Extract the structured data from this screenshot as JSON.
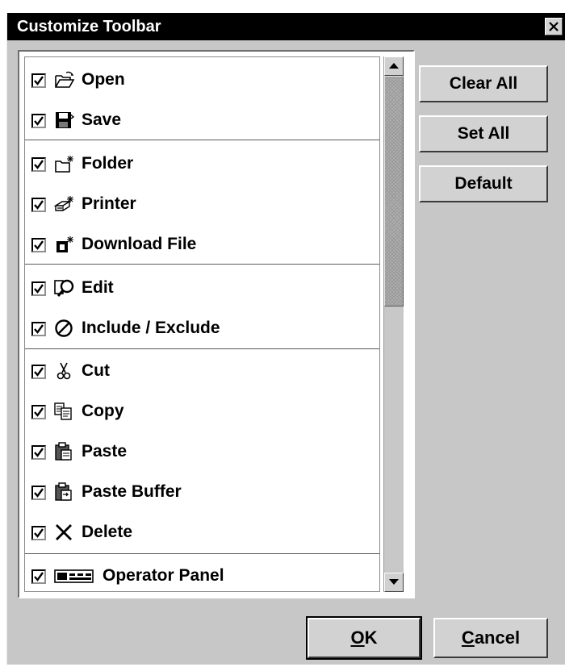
{
  "window": {
    "title": "Customize Toolbar"
  },
  "toolbar_items": [
    {
      "label": "Open",
      "checked": true,
      "icon": "open-folder-icon"
    },
    {
      "label": "Save",
      "checked": true,
      "icon": "save-disk-icon"
    },
    {
      "label": "Folder",
      "checked": true,
      "icon": "new-folder-icon"
    },
    {
      "label": "Printer",
      "checked": true,
      "icon": "new-printer-icon"
    },
    {
      "label": "Download File",
      "checked": true,
      "icon": "download-file-icon"
    },
    {
      "label": "Edit",
      "checked": true,
      "icon": "edit-magnifier-icon"
    },
    {
      "label": "Include / Exclude",
      "checked": true,
      "icon": "prohibited-icon"
    },
    {
      "label": "Cut",
      "checked": true,
      "icon": "scissors-icon"
    },
    {
      "label": "Copy",
      "checked": true,
      "icon": "copy-icon"
    },
    {
      "label": "Paste",
      "checked": true,
      "icon": "clipboard-icon"
    },
    {
      "label": "Paste Buffer",
      "checked": true,
      "icon": "paste-buffer-icon"
    },
    {
      "label": "Delete",
      "checked": true,
      "icon": "delete-x-icon"
    },
    {
      "label": "Operator Panel",
      "checked": true,
      "icon": "operator-panel-icon"
    }
  ],
  "side_buttons": {
    "clear_all": "Clear All",
    "set_all": "Set All",
    "default": "Default"
  },
  "dialog_buttons": {
    "ok_mnemonic": "O",
    "ok_rest": "K",
    "cancel_mnemonic": "C",
    "cancel_rest": "ancel"
  }
}
